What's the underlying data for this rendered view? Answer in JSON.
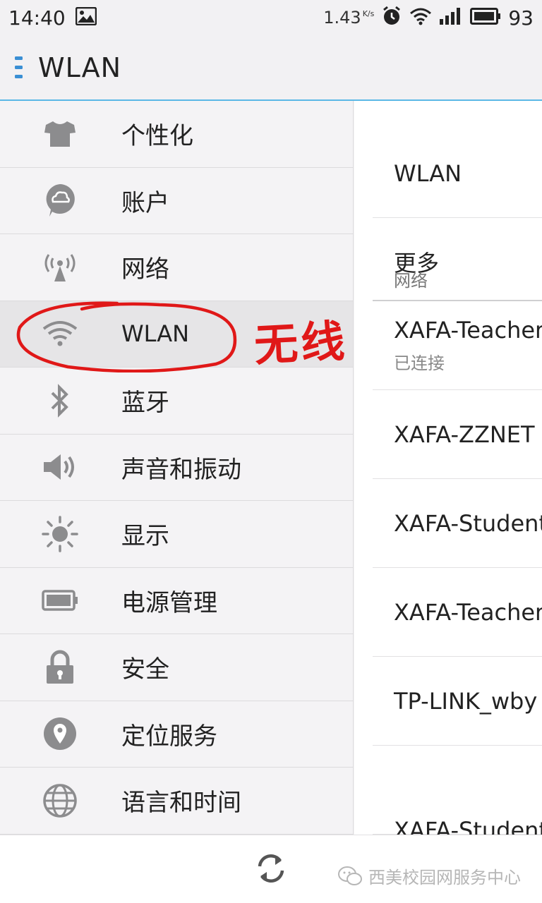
{
  "status_bar": {
    "time": "14:40",
    "speed": "1.43",
    "speed_unit": "K/s",
    "battery_pct": "93"
  },
  "header": {
    "title": "WLAN"
  },
  "categories": [
    {
      "label": "个性化",
      "icon": "tshirt-icon"
    },
    {
      "label": "账户",
      "icon": "cloud-account-icon"
    },
    {
      "label": "网络",
      "icon": "antenna-icon"
    },
    {
      "label": "WLAN",
      "icon": "wifi-icon",
      "selected": true
    },
    {
      "label": "蓝牙",
      "icon": "bluetooth-icon"
    },
    {
      "label": "声音和振动",
      "icon": "speaker-icon"
    },
    {
      "label": "显示",
      "icon": "brightness-icon"
    },
    {
      "label": "电源管理",
      "icon": "battery-icon"
    },
    {
      "label": "安全",
      "icon": "lock-icon"
    },
    {
      "label": "定位服务",
      "icon": "location-pin-icon"
    },
    {
      "label": "语言和时间",
      "icon": "globe-icon"
    }
  ],
  "detail": {
    "wlan_toggle_label": "WLAN",
    "more_label": "更多",
    "networks_header": "网络",
    "networks": [
      {
        "ssid": "XAFA-Teacher",
        "status": "已连接"
      },
      {
        "ssid": "XAFA-ZZNET"
      },
      {
        "ssid": "XAFA-Student"
      },
      {
        "ssid": "XAFA-Teacher"
      },
      {
        "ssid": "TP-LINK_wby"
      },
      {
        "ssid": "XAFA-Student"
      }
    ]
  },
  "annotation": {
    "text": "无线",
    "color": "#e01818"
  },
  "watermark": {
    "text": "西美校园网服务中心"
  },
  "colors": {
    "accent": "#5bb8e6",
    "icon_gray": "#8c8c8e",
    "annotation_red": "#e01818"
  }
}
